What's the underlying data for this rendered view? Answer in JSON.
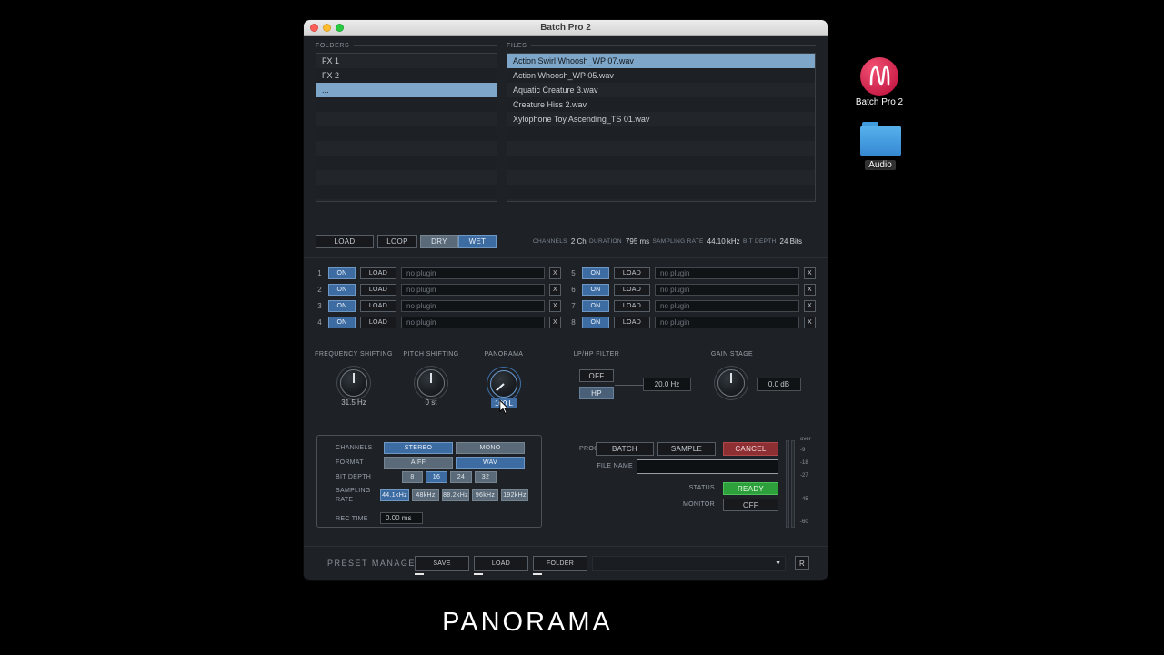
{
  "window": {
    "title": "Batch Pro 2"
  },
  "folders": {
    "label": "FOLDERS",
    "items": [
      {
        "name": "FX 1"
      },
      {
        "name": "FX 2"
      },
      {
        "name": "..."
      }
    ]
  },
  "files": {
    "label": "FILES",
    "items": [
      {
        "name": "Action Swirl Whoosh_WP 07.wav"
      },
      {
        "name": "Action Whoosh_WP 05.wav"
      },
      {
        "name": "Aquatic Creature 3.wav"
      },
      {
        "name": "Creature Hiss 2.wav"
      },
      {
        "name": "Xylophone Toy Ascending_TS 01.wav"
      }
    ]
  },
  "sample_controls": {
    "load": "LOAD",
    "loop": "LOOP",
    "dry": "DRY",
    "wet": "WET"
  },
  "file_info": {
    "channels_label": "CHANNELS",
    "channels_value": "2 Ch",
    "duration_label": "DURATION",
    "duration_value": "795 ms",
    "sampling_rate_label": "SAMPLING RATE",
    "sampling_rate_value": "44.10 kHz",
    "bit_depth_label": "BIT DEPTH",
    "bit_depth_value": "24 Bits"
  },
  "plugins": {
    "on_label": "ON",
    "load_label": "LOAD",
    "remove_label": "X",
    "slots": [
      {
        "num": "1",
        "name": "no plugin"
      },
      {
        "num": "2",
        "name": "no plugin"
      },
      {
        "num": "3",
        "name": "no plugin"
      },
      {
        "num": "4",
        "name": "no plugin"
      },
      {
        "num": "5",
        "name": "no plugin"
      },
      {
        "num": "6",
        "name": "no plugin"
      },
      {
        "num": "7",
        "name": "no plugin"
      },
      {
        "num": "8",
        "name": "no plugin"
      }
    ]
  },
  "dsp": {
    "frequency_shifting": {
      "label": "FREQUENCY SHIFTING",
      "value": "31.5 Hz"
    },
    "pitch_shifting": {
      "label": "PITCH SHIFTING",
      "value": "0 st"
    },
    "panorama": {
      "label": "PANORAMA",
      "value": "100 L"
    },
    "filter": {
      "label": "LP/HP FILTER",
      "off": "OFF",
      "hp": "HP",
      "freq_value": "20.0 Hz"
    },
    "gain_stage": {
      "label": "GAIN STAGE",
      "value": "0.0 dB"
    }
  },
  "output": {
    "channels_label": "CHANNELS",
    "channels_options": [
      "STEREO",
      "MONO"
    ],
    "channels_selected": "STEREO",
    "format_label": "FORMAT",
    "format_options": [
      "AIFF",
      "WAV"
    ],
    "format_selected": "WAV",
    "bit_depth_label": "BIT DEPTH",
    "bit_depth_options": [
      "8",
      "16",
      "24",
      "32"
    ],
    "bit_depth_selected": "16",
    "sampling_rate_label": "SAMPLING RATE",
    "sampling_rate_options": [
      "44.1kHz",
      "48kHz",
      "88.2kHz",
      "96kHz",
      "192kHz"
    ],
    "sampling_rate_selected": "44.1kHz",
    "rec_time_label": "REC TIME",
    "rec_time_value": "0.00 ms"
  },
  "process": {
    "label": "PROCESS",
    "batch": "BATCH",
    "sample": "SAMPLE",
    "cancel": "CANCEL",
    "file_name_label": "FILE NAME",
    "file_name_value": "",
    "status_label": "STATUS",
    "status_value": "READY",
    "monitor_label": "MONITOR",
    "monitor_value": "OFF"
  },
  "meter": {
    "ticks": [
      "over",
      "-9",
      "-18",
      "-27",
      "-45",
      "-60"
    ]
  },
  "preset_manager": {
    "label": "PRESET MANAGER",
    "save": "SAVE",
    "load": "LOAD",
    "folder": "FOLDER",
    "reset": "R"
  },
  "desktop": {
    "app_label": "Batch Pro 2",
    "folder_label": "Audio"
  },
  "caption": "PANORAMA",
  "colors": {
    "accent_blue": "#3d6ca3",
    "selection_blue": "#7ea6c8",
    "cancel_red": "#8e2f33",
    "ready_green": "#2da03c",
    "app_icon_red": "#d9204c",
    "folder_blue": "#4aa0e0"
  }
}
